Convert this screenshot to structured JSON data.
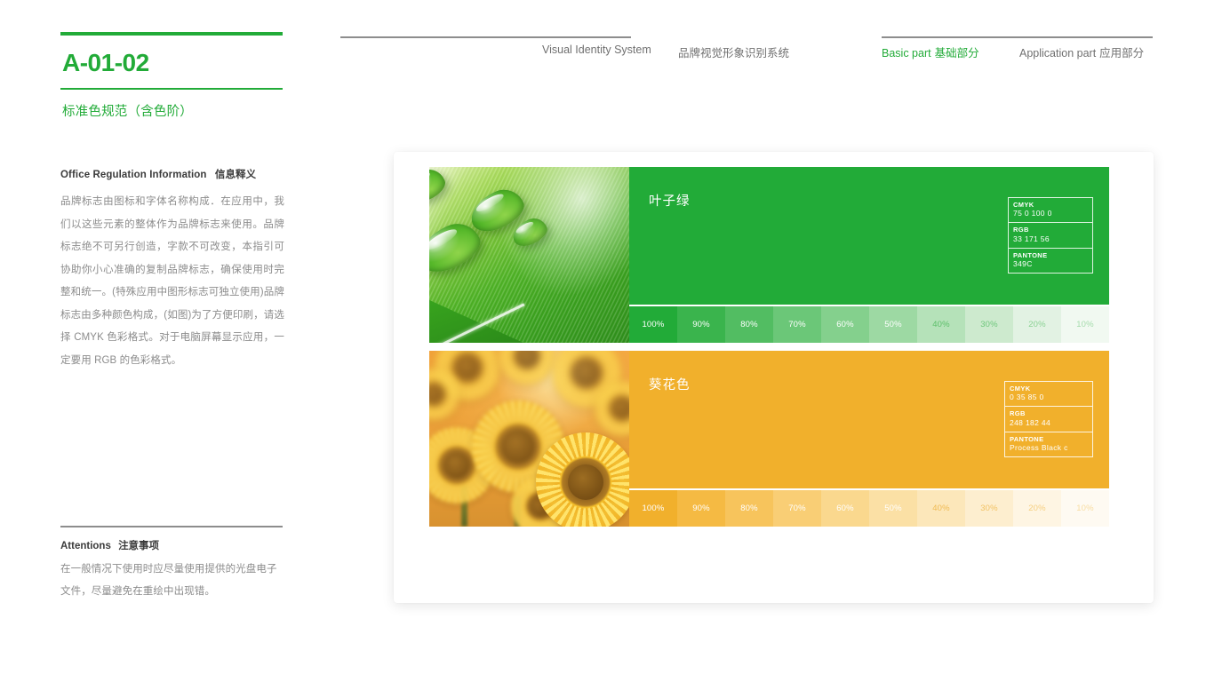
{
  "page": {
    "code": "A-01-02",
    "section_title": "标准色规范（含色阶）",
    "accent_green": "#22ab38"
  },
  "header": {
    "system_en": "Visual Identity System",
    "system_cn": "品牌视觉形象识别系统",
    "nav": [
      {
        "en": "Basic part",
        "cn": "基础部分",
        "active": true
      },
      {
        "en": "Application part",
        "cn": "应用部分",
        "active": false
      }
    ]
  },
  "info": {
    "heading_en": "Office Regulation Information",
    "heading_cn": "信息释义",
    "body": "品牌标志由图标和字体名称构成．在应用中，我们以这些元素的整体作为品牌标志来使用。品牌标志绝不可另行创造，字款不可改变，本指引可协助你小心准确的复制品牌标志，确保使用时完整和统一。(特殊应用中图形标志可独立使用)品牌标志由多种颜色构成，(如图)为了方便印刷，请选择 CMYK 色彩格式。对于电脑屏幕显示应用，一定要用 RGB 的色彩格式。"
  },
  "attentions": {
    "heading_en": "Attentions",
    "heading_cn": "注意事项",
    "body": "在一般情况下使用时应尽量使用提供的光盘电子文件，尽量避免在重绘中出现错。"
  },
  "swatches": [
    {
      "id": "leaf-green",
      "name": "叶子绿",
      "photo_name": "green-leaf-water-drops-photo",
      "base_color": "#22ab38",
      "specs": [
        {
          "label": "CMYK",
          "value": "75  0 100  0"
        },
        {
          "label": "RGB",
          "value": "33 171 56"
        },
        {
          "label": "PANTONE",
          "value": "349C"
        }
      ],
      "tints": [
        {
          "label": "100%",
          "color": "#22ab38",
          "text": "#ffffff"
        },
        {
          "label": "90%",
          "color": "#3ab44d",
          "text": "#ffffff"
        },
        {
          "label": "80%",
          "color": "#52bd62",
          "text": "#ffffff"
        },
        {
          "label": "70%",
          "color": "#6bc778",
          "text": "#ffffff"
        },
        {
          "label": "60%",
          "color": "#84d08d",
          "text": "#ffffff"
        },
        {
          "label": "50%",
          "color": "#9dd9a3",
          "text": "#ffffff"
        },
        {
          "label": "40%",
          "color": "#b5e2b9",
          "text": "#5cbf6a"
        },
        {
          "label": "30%",
          "color": "#cdeace",
          "text": "#6fc77c"
        },
        {
          "label": "20%",
          "color": "#e2f2e3",
          "text": "#8bd294"
        },
        {
          "label": "10%",
          "color": "#f1f9f1",
          "text": "#a5dcac"
        }
      ]
    },
    {
      "id": "sunflower",
      "name": "葵花色",
      "photo_name": "sunflower-field-photo",
      "base_color": "#f1b02c",
      "specs": [
        {
          "label": "CMYK",
          "value": "0 35 85 0"
        },
        {
          "label": "RGB",
          "value": "248 182 44"
        },
        {
          "label": "PANTONE",
          "value": "Process Black c"
        }
      ],
      "tints": [
        {
          "label": "100%",
          "color": "#f1b02c",
          "text": "#ffffff"
        },
        {
          "label": "90%",
          "color": "#f5ba43",
          "text": "#ffffff"
        },
        {
          "label": "80%",
          "color": "#f7c45c",
          "text": "#ffffff"
        },
        {
          "label": "70%",
          "color": "#f9ce75",
          "text": "#ffffff"
        },
        {
          "label": "60%",
          "color": "#fad88e",
          "text": "#ffffff"
        },
        {
          "label": "50%",
          "color": "#fbe0a5",
          "text": "#ffffff"
        },
        {
          "label": "40%",
          "color": "#fce7ba",
          "text": "#f0ba52"
        },
        {
          "label": "30%",
          "color": "#fdeecf",
          "text": "#f2c264"
        },
        {
          "label": "20%",
          "color": "#fef5e3",
          "text": "#f6cf80"
        },
        {
          "label": "10%",
          "color": "#fefaf2",
          "text": "#f8dda2"
        }
      ]
    }
  ]
}
